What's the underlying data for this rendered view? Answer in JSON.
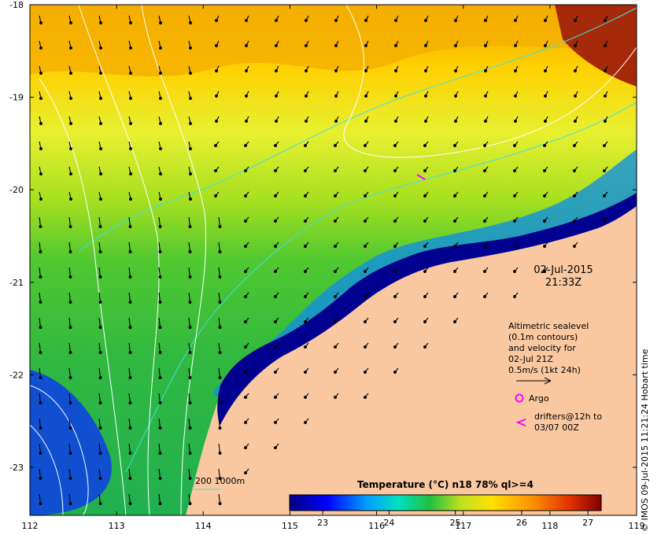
{
  "map": {
    "x_axis": {
      "ticks": [
        "112",
        "113",
        "114",
        "115",
        "116",
        "117",
        "118",
        "119"
      ]
    },
    "y_axis": {
      "ticks": [
        "-18",
        "-19",
        "-20",
        "-21",
        "-22",
        "-23"
      ]
    },
    "date": "02-Jul-2015",
    "time": "21:33Z",
    "legend_lines": [
      "Altimetric sealevel",
      "(0.1m contours)",
      "and velocity for",
      "02-Jul 21Z",
      "0.5m/s  (1kt 24h)"
    ],
    "argo_label": "Argo",
    "drifters_lines": [
      "drifters@12h to",
      "03/07 00Z"
    ],
    "isobath_label": "200  1000m",
    "colorbar": {
      "title": "Temperature (°C) n18 78% ql>=4",
      "ticks": [
        "23",
        "24",
        "25",
        "26",
        "27"
      ],
      "min": 22.5,
      "max": 27.2
    },
    "credit": "© IMOS 09-Jul-2015 11:21:24 Hobart time",
    "colors": {
      "land": "#f9c8a0",
      "cold": "#00008b",
      "warm": "#8b1a00",
      "argo": "#ff00ff",
      "isobath": "#40e0e0",
      "contour": "#ffffff"
    }
  }
}
